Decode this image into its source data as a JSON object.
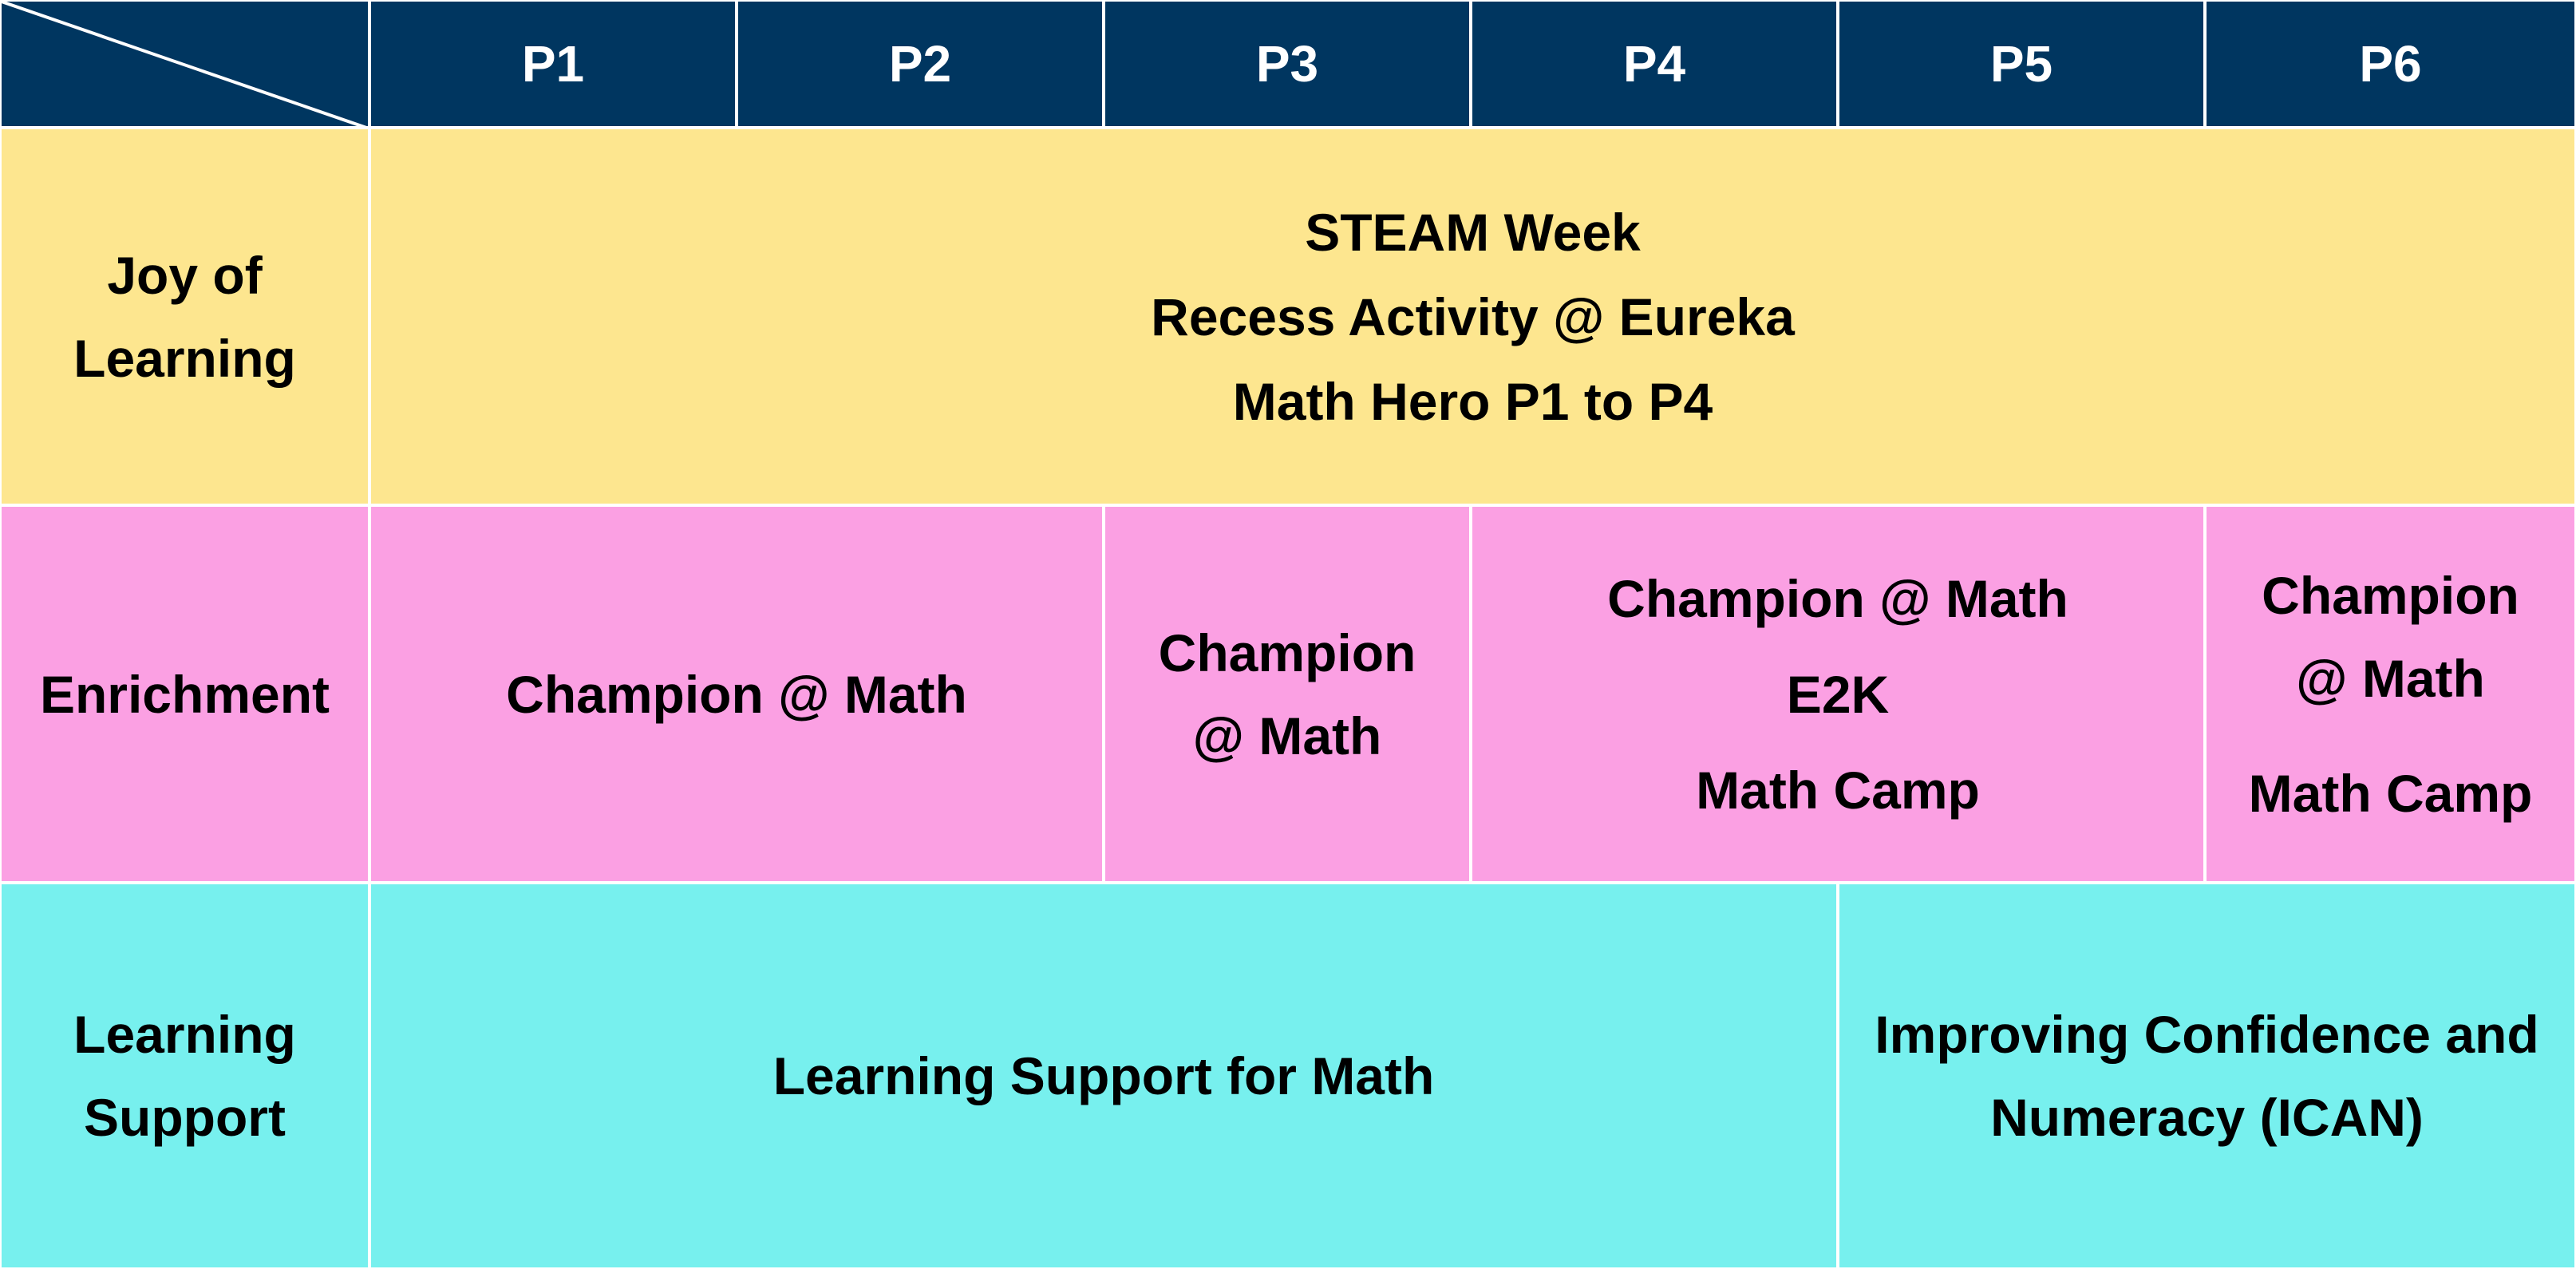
{
  "header": {
    "columns": [
      "P1",
      "P2",
      "P3",
      "P4",
      "P5",
      "P6"
    ]
  },
  "rows": {
    "joy": {
      "label": "Joy of\nLearning",
      "content": "STEAM Week\nRecess Activity @ Eureka\nMath Hero P1 to P4"
    },
    "enrichment": {
      "label": "Enrichment",
      "p1_p2": "Champion @ Math",
      "p3": "Champion\n@ Math",
      "p4_p5": "Champion @ Math\nE2K\nMath Camp",
      "p6_top": "Champion\n@ Math",
      "p6_bottom": "Math Camp"
    },
    "support": {
      "label": "Learning\nSupport",
      "p1_p4": "Learning Support for Math",
      "p5_p6": "Improving Confidence and\nNumeracy (ICAN)"
    }
  },
  "colors": {
    "header": "#003660",
    "joy": "#fde68f",
    "enrichment": "#fba0e3",
    "support": "#77f0ee"
  }
}
